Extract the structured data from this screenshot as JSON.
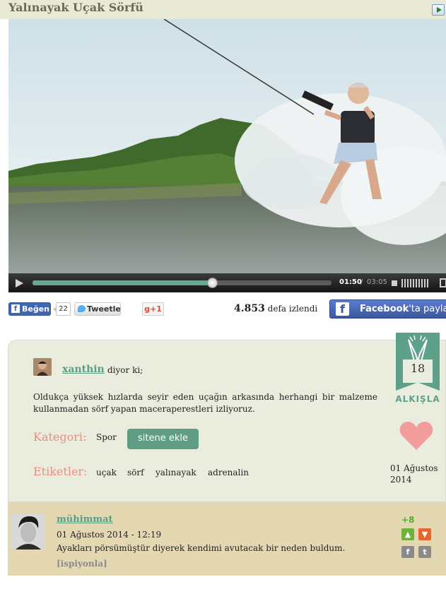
{
  "page": {
    "title": "Yalınayak Uçak Sörfü"
  },
  "video": {
    "current_time": "01:50",
    "separator": "/",
    "duration": "03:05",
    "progress": 0.6
  },
  "social": {
    "like_label": "Beğen",
    "like_count": "22",
    "tweet_label": "Tweetle",
    "gplus_label": "g+1",
    "views_count": "4.853",
    "views_suffix": "defa izlendi",
    "fb_share_bold": "Facebook",
    "fb_share_rest": "'ta paylaş"
  },
  "post": {
    "author": "xanthin",
    "says": "diyor ki;",
    "description": "Oldukça yüksek hızlarda seyir eden uçağın arkasında herhangi bir malzeme kullanmadan sörf yapan maceraperestleri izliyoruz.",
    "category_label": "Kategori:",
    "category_value": "Spor",
    "add_button": "sitene ekle",
    "tags_label": "Etiketler:",
    "tags": [
      "uçak",
      "sörf",
      "yalınayak",
      "adrenalin"
    ],
    "clap_count": "18",
    "clap_label": "ALKIŞLA",
    "date": "01 Ağustos 2014"
  },
  "comment": {
    "user": "mühimmat",
    "datetime": "01 Ağustos 2014 - 12:19",
    "text": "Ayakları pörsümüştür diyerek kendimi avutacak bir neden buldum.",
    "report": "[ispiyonla]",
    "score": "+8"
  },
  "colors": {
    "accent_green": "#5fa08a",
    "label_pink": "#e88f80",
    "facebook_blue": "#3b5998"
  }
}
